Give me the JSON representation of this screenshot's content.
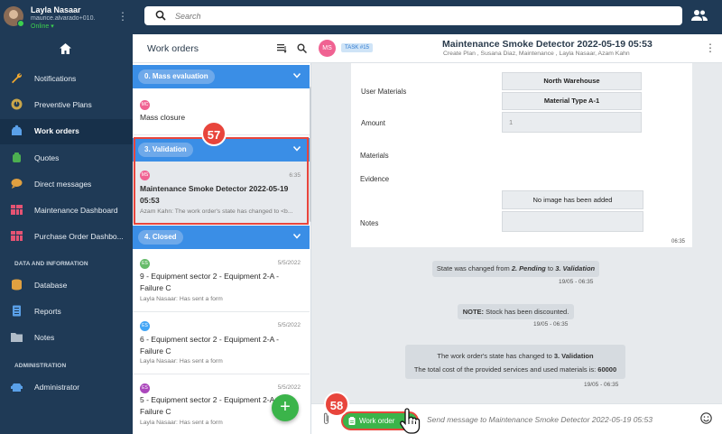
{
  "topbar": {
    "user_name": "Layla Nasaar",
    "user_email": "maurice.alvarado+010...",
    "user_status": "Online",
    "search_placeholder": "Search"
  },
  "sidebar": {
    "items": [
      {
        "label": "Notifications",
        "icon": "wrench-icon"
      },
      {
        "label": "Preventive Plans",
        "icon": "gauge-icon"
      },
      {
        "label": "Work orders",
        "icon": "clipboard-icon",
        "active": true
      },
      {
        "label": "Quotes",
        "icon": "quote-icon"
      },
      {
        "label": "Direct messages",
        "icon": "chat-icon"
      },
      {
        "label": "Maintenance Dashboard",
        "icon": "dashboard-icon"
      },
      {
        "label": "Purchase Order Dashbo...",
        "icon": "dashboard-icon"
      }
    ],
    "section_data": "DATA AND INFORMATION",
    "data_items": [
      {
        "label": "Database",
        "icon": "database-icon"
      },
      {
        "label": "Reports",
        "icon": "reports-icon"
      },
      {
        "label": "Notes",
        "icon": "folder-icon"
      }
    ],
    "section_admin": "ADMINISTRATION",
    "admin_items": [
      {
        "label": "Administrator",
        "icon": "admin-icon"
      }
    ]
  },
  "list": {
    "title": "Work orders",
    "groups": [
      {
        "label": "0. Mass evaluation"
      },
      {
        "label": "3. Validation"
      },
      {
        "label": "4. Closed"
      }
    ],
    "cards": [
      {
        "initials": "MC",
        "title": "Mass closure",
        "date": "",
        "sub": ""
      },
      {
        "initials": "MS",
        "title": "Maintenance Smoke Detector 2022-05-19 05:53",
        "date": "6:35",
        "sub": "Azam Kahn: The work order's state has changed to <b..."
      },
      {
        "initials": "ES",
        "title": "9 - Equipment sector 2 - Equipment 2-A - Failure C",
        "date": "5/5/2022",
        "sub": "Layla Nasaar: Has sent a form"
      },
      {
        "initials": "ES",
        "title": "6 - Equipment sector 2 - Equipment 2-A - Failure C",
        "date": "5/5/2022",
        "sub": "Layla Nasaar: Has sent a form"
      },
      {
        "initials": "ES",
        "title": "5 - Equipment sector 2 - Equipment 2-A - Failure C",
        "date": "5/5/2022",
        "sub": "Layla Nasaar: Has sent a form"
      }
    ],
    "fab_label": "+"
  },
  "badges": {
    "first": "57",
    "second": "58"
  },
  "chat": {
    "avatar": "MS",
    "task": "TASK #15",
    "title": "Maintenance Smoke Detector 2022-05-19 05:53",
    "subtitle": "Create Plan , Susana Diaz, Maintenance , Layla Nasaar, Azam Kahn",
    "form": {
      "user_materials_label": "User Materials",
      "warehouse": "North Warehouse",
      "material_type": "Material Type A-1",
      "amount_label": "Amount",
      "amount_value": "1",
      "materials_label": "Materials",
      "evidence_label": "Evidence",
      "no_image": "No image has been added",
      "notes_label": "Notes",
      "time": "06:35"
    },
    "messages": {
      "m1_prefix": "State was changed from ",
      "m1_from": "2. Pending",
      "m1_mid": " to ",
      "m1_to": "3. Validation",
      "m1_time": "19/05 - 06:35",
      "m2_bold": "NOTE:",
      "m2_text": " Stock has been discounted.",
      "m2_time": "19/05 - 06:35",
      "m3_prefix": "The work order's state has changed to ",
      "m3_state": "3. Validation",
      "m3_cost": "The total cost of the provided services and used materials is: ",
      "m3_amount": "60000",
      "m3_time": "19/05 - 06:35"
    },
    "work_order_button": "Work order",
    "input_placeholder": "Send message to Maintenance Smoke Detector 2022-05-19 05:53"
  },
  "colors": {
    "sidebar_bg": "#1f3a56",
    "group_blue": "#3a8ee6",
    "accent_green": "#3bb44a",
    "highlight_red": "#e8453c",
    "avatar_pink": "#f06292",
    "avatar_blue": "#42a5f5",
    "avatar_green": "#66bb6a",
    "avatar_purple": "#ab47bc"
  }
}
